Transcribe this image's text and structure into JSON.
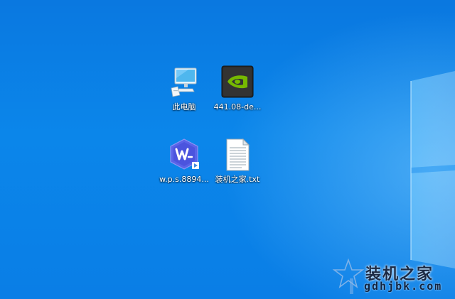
{
  "desktop": {
    "background_color": "#0a7ee6",
    "icons": [
      {
        "label": "此电脑",
        "icon": "computer-icon"
      },
      {
        "label": "441.08-de...",
        "icon": "nvidia-icon"
      },
      {
        "label": "w.p.s.8894...",
        "icon": "wps-icon"
      },
      {
        "label": "装机之家.txt",
        "icon": "text-file-icon"
      }
    ]
  },
  "watermark": {
    "title": "装机之家",
    "subtitle": "gdhjbk.com"
  }
}
